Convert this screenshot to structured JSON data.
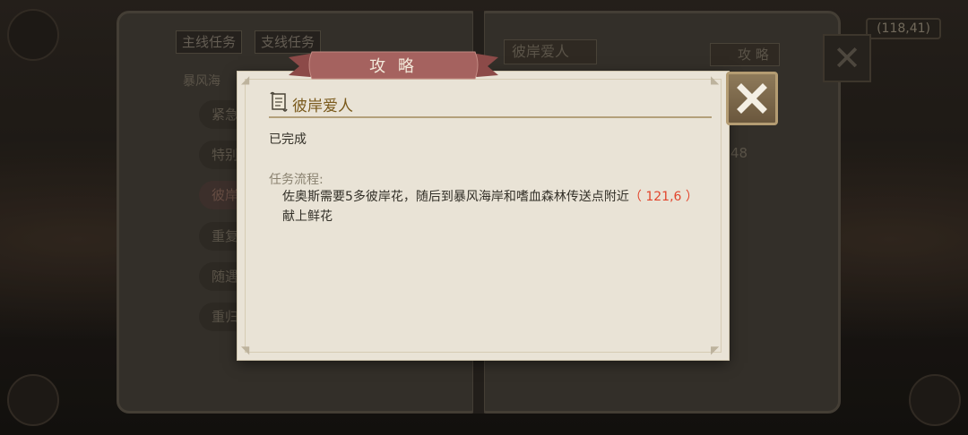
{
  "background": {
    "coord_readout": "(118,41)",
    "tabs": [
      "主线任务",
      "支线任务"
    ],
    "list_heading": "暴风海",
    "quest_items": [
      {
        "label": "紧急",
        "active": false
      },
      {
        "label": "特别",
        "active": false
      },
      {
        "label": "彼岸",
        "active": true
      },
      {
        "label": "重复",
        "active": false
      },
      {
        "label": "随遇",
        "active": false
      },
      {
        "label": "重归",
        "active": false
      }
    ],
    "right_title": "彼岸爱人",
    "guide_tab_label": "攻 略",
    "side_number": "48"
  },
  "dialog": {
    "ribbon_title": "攻 略",
    "quest_title": "彼岸爱人",
    "status": "已完成",
    "section_label": "任务流程:",
    "description_before": "佐奥斯需要5多彼岸花，随后到暴风海岸和嗜血森林传送点附近",
    "coordinate": "（ 121,6 ）",
    "description_after": "献上鲜花"
  },
  "colors": {
    "dialog_bg": "#e9e3d6",
    "ribbon": "#a5625f",
    "title_gold": "#7a5a1c",
    "coordinate_red": "#e2452c",
    "close_button": "#7a664a"
  },
  "icons": {
    "close": "close-x-icon",
    "scroll": "scroll-icon"
  }
}
